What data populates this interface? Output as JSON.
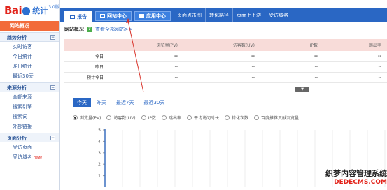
{
  "logo": {
    "brand_bai": "Bai",
    "brand_tj": "统计",
    "version": "3.0版"
  },
  "sidebar": {
    "active": "网站概况",
    "groups": [
      {
        "title": "趋势分析",
        "items": [
          "实时访客",
          "今日统计",
          "昨日统计",
          "最近30天"
        ]
      },
      {
        "title": "来源分析",
        "items": [
          "全部来源",
          "搜索引擎",
          "搜索词",
          "外部链接"
        ]
      },
      {
        "title": "页面分析",
        "items": [
          "受访页面",
          "受访域名"
        ],
        "new_badge": "new!"
      }
    ]
  },
  "topnav": {
    "report_tab": "报告",
    "web_center_tab": "网站中心",
    "app_center_tab": "应用中心",
    "links": [
      "页面点击图",
      "转化路径",
      "页面上下游",
      "受访域名"
    ]
  },
  "overview": {
    "title": "网站概况",
    "help_icon_text": "?",
    "view_all_link": "查看全部网站>>"
  },
  "summary_table": {
    "headers": [
      "",
      "浏览量(PV)",
      "访客数(UV)",
      "IP数",
      "跳出率"
    ],
    "rows": [
      {
        "label": "今日",
        "values": [
          "--",
          "--",
          "--",
          "--"
        ]
      },
      {
        "label": "昨日",
        "values": [
          "--",
          "--",
          "--",
          "--"
        ]
      },
      {
        "label": "预计今日",
        "values": [
          "--",
          "--",
          "--",
          "--"
        ]
      }
    ],
    "expand_icon": "▼"
  },
  "periods": [
    "今天",
    "昨天",
    "最近7天",
    "最近30天"
  ],
  "metrics": [
    "浏览量(PV)",
    "访客数(UV)",
    "IP数",
    "跳出率",
    "平均访问时长",
    "转化次数",
    "百度推荐贡献浏览量"
  ],
  "chart_data": {
    "type": "line",
    "y_ticks": [
      "5",
      "4",
      "3",
      "2",
      "1"
    ],
    "ylim": [
      0,
      5
    ],
    "series": []
  },
  "watermark": {
    "line1": "织梦内容管理系统",
    "line2": "DEDECMS.COM"
  },
  "colors": {
    "nav_blue": "#2a67c4",
    "active_orange": "#f26b3a",
    "header_pink": "#f8dcd9",
    "annotation_red": "#d9342b"
  }
}
